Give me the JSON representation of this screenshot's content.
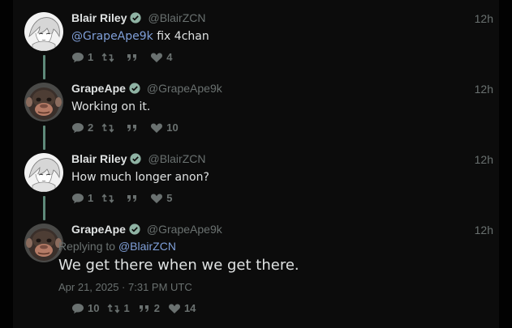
{
  "tweets": [
    {
      "name": "Blair Riley",
      "handle": "@BlairZCN",
      "time": "12h",
      "mention": "@GrapeApe9k",
      "text": " fix 4chan",
      "replies": "1",
      "retweets": "",
      "quotes": "",
      "likes": "4",
      "avatar": "anime-avatar"
    },
    {
      "name": "GrapeApe",
      "handle": "@GrapeApe9k",
      "time": "12h",
      "mention": "",
      "text": "Working on it.",
      "replies": "2",
      "retweets": "",
      "quotes": "",
      "likes": "10",
      "avatar": "ape-avatar"
    },
    {
      "name": "Blair Riley",
      "handle": "@BlairZCN",
      "time": "12h",
      "mention": "",
      "text": "How much longer anon?",
      "replies": "1",
      "retweets": "",
      "quotes": "",
      "likes": "5",
      "avatar": "anime-avatar"
    },
    {
      "name": "GrapeApe",
      "handle": "@GrapeApe9k",
      "time": "12h",
      "reply_prefix": "Replying to ",
      "reply_to": "@BlairZCN",
      "text": "We get there when we get there.",
      "date": "Apr 21, 2025 · 7:31 PM UTC",
      "replies": "10",
      "retweets": "1",
      "quotes": "2",
      "likes": "14",
      "avatar": "ape-avatar"
    }
  ],
  "colors": {
    "background": "#0c0c0c",
    "text": "#dfe2e2",
    "muted": "#6a7170",
    "mention": "#7f9fd8",
    "thread_line": "#5f8a7a",
    "verified": "#8fb3a4"
  },
  "icons": [
    "comment-icon",
    "retweet-icon",
    "quote-icon",
    "heart-icon",
    "verified-badge-icon"
  ]
}
